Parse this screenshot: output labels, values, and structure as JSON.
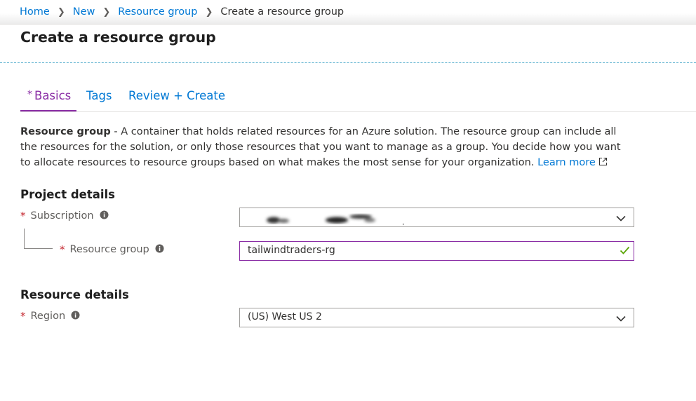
{
  "breadcrumb": {
    "items": [
      "Home",
      "New",
      "Resource group"
    ],
    "current": "Create a resource group"
  },
  "page": {
    "title": "Create a resource group"
  },
  "tabs": {
    "basics": "Basics",
    "tags": "Tags",
    "review": "Review + Create",
    "required_marker": "*"
  },
  "description": {
    "lead": "Resource group",
    "body": " - A container that holds related resources for an Azure solution. The resource group can include all the resources for the solution, or only those resources that you want to manage as a group. You decide how you want to allocate resources to resource groups based on what makes the most sense for your organization. ",
    "learn_more": "Learn more"
  },
  "project_details": {
    "title": "Project details",
    "subscription_label": "Subscription",
    "resource_group_label": "Resource group",
    "resource_group_value": "tailwindtraders-rg"
  },
  "resource_details": {
    "title": "Resource details",
    "region_label": "Region",
    "region_value": "(US) West US 2"
  },
  "required_marker": "*",
  "colors": {
    "accent": "#8a2da5",
    "link": "#0078d4",
    "required": "#c4262e",
    "valid": "#57a300"
  },
  "icons": [
    "chevron-right-icon",
    "external-link-icon",
    "info-icon",
    "chevron-down-icon",
    "checkmark-icon"
  ]
}
